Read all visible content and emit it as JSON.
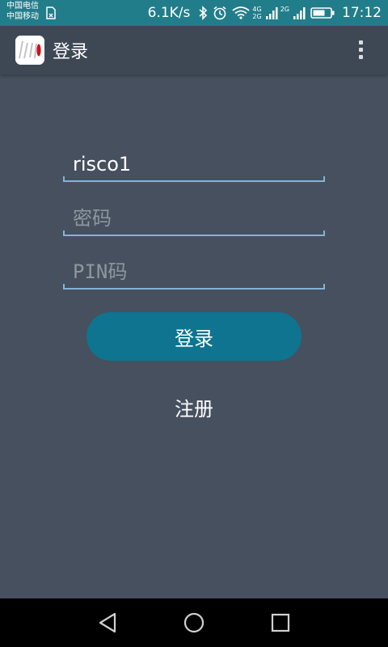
{
  "status_bar": {
    "carrier_1": "中国电信",
    "carrier_2": "中国移动",
    "net_speed": "6.1K/s",
    "net_type_1_top": "4G",
    "net_type_1_bottom": "2G",
    "net_type_2": "2G",
    "time": "17:12",
    "icons": [
      "sim-icon",
      "bluetooth-icon",
      "alarm-icon",
      "wifi-icon",
      "signal-icon",
      "signal-icon",
      "battery-icon"
    ]
  },
  "app_bar": {
    "title": "登录",
    "logo_icon": "risco-logo-icon",
    "menu_icon": "more-vert-icon"
  },
  "form": {
    "username": {
      "value": "risco1",
      "placeholder": ""
    },
    "password": {
      "value": "",
      "placeholder": "密码"
    },
    "pin": {
      "value": "",
      "placeholder": "PIN码"
    },
    "login_label": "登录",
    "register_label": "注册"
  },
  "nav_bar": {
    "icons": [
      "back-icon",
      "home-icon",
      "recents-icon"
    ]
  },
  "colors": {
    "status_bar": "#227d8a",
    "app_bar": "#3e4855",
    "background": "#46505e",
    "input_line": "#82b4d6",
    "button": "#0f7490"
  }
}
